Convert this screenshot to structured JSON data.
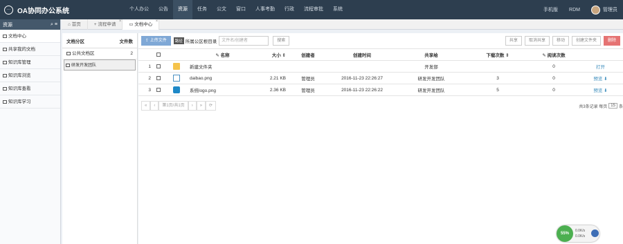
{
  "app": {
    "title": "OA协同办公系统"
  },
  "nav": {
    "items": [
      "个人办公",
      "公告",
      "资源",
      "任务",
      "公文",
      "窗口",
      "人事考勤",
      "行政",
      "流程审批",
      "系统"
    ],
    "right": [
      "手机版",
      "RDM",
      "管理员"
    ]
  },
  "sidebar": {
    "header": "资源",
    "items": [
      "文档中心",
      "共享我的文档",
      "知识库管理",
      "知识库浏览",
      "知识库查看",
      "知识库学习"
    ]
  },
  "tabs": [
    "首页",
    "流程申请",
    "文档中心"
  ],
  "left_panel": {
    "col1": "文档分区",
    "col2": "文件数",
    "rows": [
      {
        "name": "公共文档区",
        "count": "2"
      },
      {
        "name": "研发开发团队",
        "count": ""
      }
    ]
  },
  "toolbar": {
    "upload": "上传文件",
    "tag": "路径",
    "path": "所属公区根目录",
    "search_placeholder": "文件名/创建者",
    "search_btn": "搜索",
    "right_buttons": [
      "共享",
      "取消共享",
      "移动",
      "创建文件夹"
    ],
    "delete": "删除"
  },
  "table": {
    "headers": [
      "",
      "",
      "",
      "名称",
      "大小",
      "创建者",
      "创建时间",
      "共享给",
      "下载次数",
      "阅读次数",
      ""
    ],
    "rows": [
      {
        "no": "1",
        "icon": "folder",
        "name": "新建文件夹",
        "size": "",
        "creator": "",
        "time": "",
        "share": "开发部",
        "downloads": "",
        "reads": "0",
        "action": "打开"
      },
      {
        "no": "2",
        "icon": "doc",
        "name": "daibao.png",
        "size": "2.21 KB",
        "creator": "管理员",
        "time": "2016-11-23 22:26:27",
        "share": "研发开发团队",
        "downloads": "3",
        "reads": "0",
        "action": "预览"
      },
      {
        "no": "3",
        "icon": "img",
        "name": "系统logo.png",
        "size": "2.36 KB",
        "creator": "管理员",
        "time": "2016-11-23 22:26:22",
        "share": "研发开发团队",
        "downloads": "5",
        "reads": "0",
        "action": "预览"
      }
    ]
  },
  "pager": {
    "first": "«",
    "prev": "‹",
    "page": "第1页/共1页",
    "next": "›",
    "last": "»",
    "refresh": "⟳",
    "summary": "共3条记录",
    "per_label": "每页",
    "per_value": "15",
    "suffix": "条"
  },
  "widget": {
    "percent": "55%",
    "up": "0.0K/s",
    "down": "0.0K/s"
  }
}
